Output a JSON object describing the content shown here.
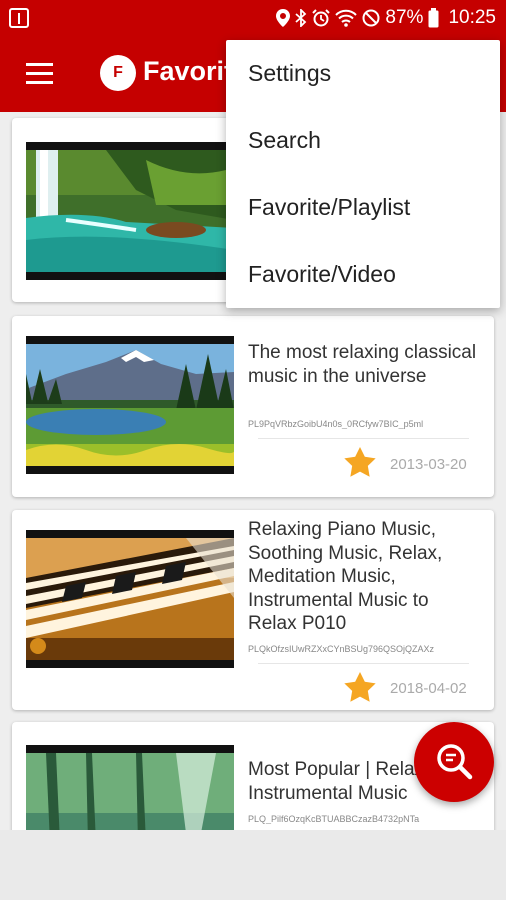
{
  "status_bar": {
    "battery_percent": "87%",
    "time": "10:25",
    "icons": [
      "usb-icon",
      "location-icon",
      "bluetooth-icon",
      "alarm-icon",
      "wifi-icon",
      "do-not-disturb-icon",
      "battery-icon"
    ]
  },
  "app_bar": {
    "title": "Favorite",
    "logo_text": "F",
    "icons": [
      "menu-icon"
    ]
  },
  "overflow_menu": {
    "items": [
      {
        "label": "Settings"
      },
      {
        "label": "Search"
      },
      {
        "label": "Favorite/Playlist"
      },
      {
        "label": "Favorite/Video"
      }
    ]
  },
  "playlists": [
    {
      "title": "",
      "id": "",
      "date": "",
      "thumbnail": "waterfall"
    },
    {
      "title": "The most relaxing classical music in the universe",
      "id": "PL9PqVRbzGoibU4n0s_0RCfyw7BIC_p5ml",
      "date": "2013-03-20",
      "thumbnail": "mountain-lake"
    },
    {
      "title": "Relaxing Piano Music, Soothing Music, Relax, Meditation Music, Instrumental Music to Relax P010",
      "id": "PLQkOfzsIUwRZXxCYnBSUg796QSOjQZAXz",
      "date": "2018-04-02",
      "thumbnail": "piano-keys"
    },
    {
      "title": "Most Popular | Relaxing Instrumental Music",
      "id": "PLQ_Pilf6OzqKcBTUABBCzazB4732pNTa",
      "date": "",
      "thumbnail": "forest-river"
    }
  ],
  "fab": {
    "icon": "search-icon"
  },
  "colors": {
    "primary": "#c50000",
    "accent_star": "#f5a623",
    "fab": "#cc0000"
  }
}
